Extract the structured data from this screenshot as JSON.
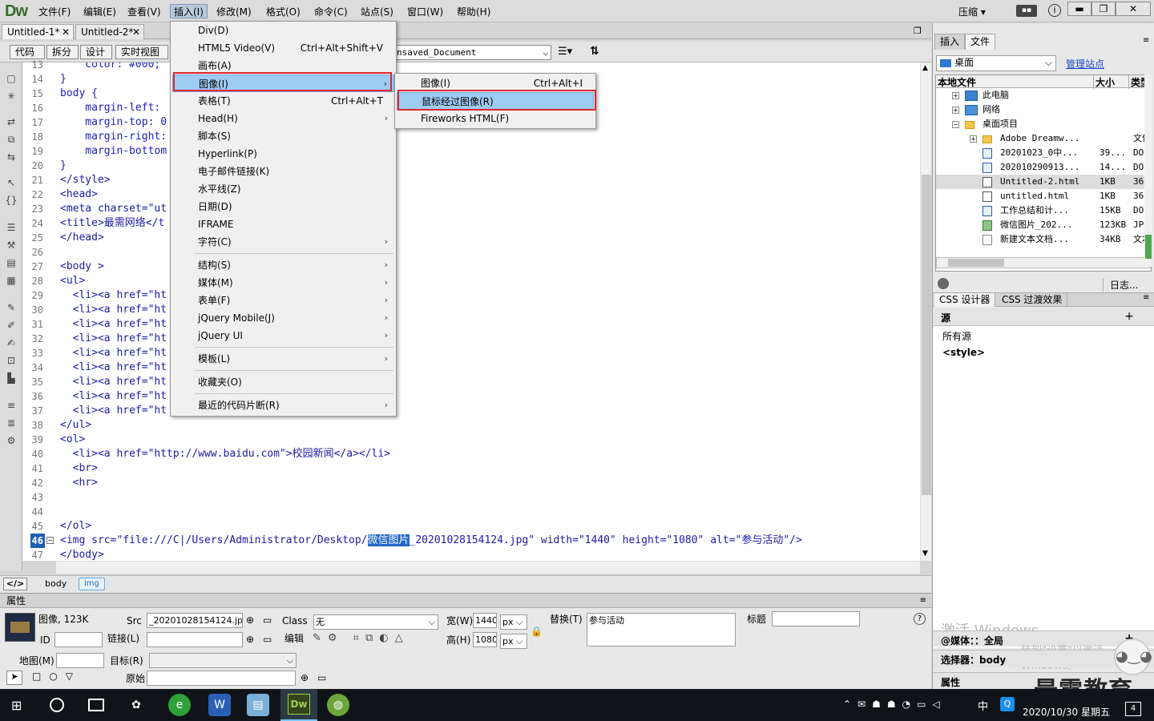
{
  "app": {
    "logo": "Dw"
  },
  "menubar": [
    "文件(F)",
    "编辑(E)",
    "查看(V)",
    "插入(I)",
    "修改(M)",
    "格式(O)",
    "命令(C)",
    "站点(S)",
    "窗口(W)",
    "帮助(H)"
  ],
  "window": {
    "workspace": "压缩",
    "search": "▾",
    "min": "▬",
    "max": "❐",
    "close": "✕"
  },
  "doctabs": [
    {
      "label": "Untitled-1*"
    },
    {
      "label": "Untitled-2*"
    }
  ],
  "toolbar": {
    "code": "代码",
    "split": "拆分",
    "design": "设计",
    "live": "实时视图",
    "doc_title": "nsaved_Document"
  },
  "code_lines": [
    {
      "n": "13",
      "t": "    color: #000;"
    },
    {
      "n": "14",
      "t": "}"
    },
    {
      "n": "15",
      "t": "body {"
    },
    {
      "n": "16",
      "t": "    margin-left:"
    },
    {
      "n": "17",
      "t": "    margin-top: 0"
    },
    {
      "n": "18",
      "t": "    margin-right:"
    },
    {
      "n": "19",
      "t": "    margin-bottom"
    },
    {
      "n": "20",
      "t": "}"
    },
    {
      "n": "21",
      "t": "</style>"
    },
    {
      "n": "22",
      "t": "<head>"
    },
    {
      "n": "23",
      "t": "<meta charset=\"ut"
    },
    {
      "n": "24",
      "t": "<title>最需网络</t"
    },
    {
      "n": "25",
      "t": "</head>"
    },
    {
      "n": "26",
      "t": ""
    },
    {
      "n": "27",
      "t": "<body >"
    },
    {
      "n": "28",
      "t": "<ul>"
    },
    {
      "n": "29",
      "t": "  <li><a href=\"ht"
    },
    {
      "n": "30",
      "t": "  <li><a href=\"ht"
    },
    {
      "n": "31",
      "t": "  <li><a href=\"ht"
    },
    {
      "n": "32",
      "t": "  <li><a href=\"ht"
    },
    {
      "n": "33",
      "t": "  <li><a href=\"ht"
    },
    {
      "n": "34",
      "t": "  <li><a href=\"ht"
    },
    {
      "n": "35",
      "t": "  <li><a href=\"ht"
    },
    {
      "n": "36",
      "t": "  <li><a href=\"ht"
    },
    {
      "n": "37",
      "t": "  <li><a href=\"ht"
    },
    {
      "n": "38",
      "t": "</ul>"
    },
    {
      "n": "39",
      "t": "<ol>"
    },
    {
      "n": "40",
      "t": "  <li><a href=\"http://www.baidu.com\">校园新闻</a></li>"
    },
    {
      "n": "41",
      "t": "  <br>"
    },
    {
      "n": "42",
      "t": "  <hr>"
    },
    {
      "n": "43",
      "t": ""
    },
    {
      "n": "44",
      "t": ""
    },
    {
      "n": "45",
      "t": "</ol>"
    },
    {
      "n": "46",
      "t": ""
    },
    {
      "n": "47",
      "t": "</body>"
    }
  ],
  "img_line": {
    "pre": "<img src=\"file:///C|/Users/Administrator/Desktop/",
    "sel": "微信图片",
    "post": "_20201028154124.jpg\" width=\"1440\" height=\"1080\" alt=\"参与活动\"/>"
  },
  "tagbar": {
    "code_btn": "</>",
    "body": "body",
    "img": "img"
  },
  "props": {
    "title": "属性",
    "kind": "图像, 123K",
    "src_label": "Src",
    "src_value": "_20201028154124.jpg",
    "class_label": "Class",
    "class_value": "无",
    "width_label": "宽(W)",
    "width_value": "1440",
    "height_label": "高(H)",
    "height_value": "1080",
    "unit": "px",
    "alt_label": "替换(T)",
    "alt_value": "参与活动",
    "title_label": "标题",
    "id_label": "ID",
    "link_label": "链接(L)",
    "edit_label": "编辑",
    "map_label": "地图(M)",
    "target_label": "目标(R)",
    "original_label": "原始"
  },
  "right": {
    "tabs": [
      "插入",
      "文件"
    ],
    "location": "桌面",
    "manage": "管理站点",
    "col_name": "本地文件",
    "col_size": "大小",
    "col_type": "类型",
    "files": [
      {
        "name": "此电脑",
        "size": "",
        "type": "",
        "icon": "pc",
        "indent": 1
      },
      {
        "name": "网络",
        "size": "",
        "type": "",
        "icon": "net",
        "indent": 1
      },
      {
        "name": "桌面项目",
        "size": "",
        "type": "",
        "icon": "folder",
        "indent": 1
      },
      {
        "name": "Adobe Dreamw...",
        "size": "",
        "type": "文件",
        "icon": "folder",
        "indent": 2
      },
      {
        "name": "20201023_0中...",
        "size": "39...",
        "type": "DOCX",
        "icon": "word",
        "indent": 2
      },
      {
        "name": "202010290913...",
        "size": "14...",
        "type": "DOCX",
        "icon": "word",
        "indent": 2
      },
      {
        "name": "Untitled-2.html",
        "size": "1KB",
        "type": "360",
        "icon": "html",
        "indent": 2
      },
      {
        "name": "untitled.html",
        "size": "1KB",
        "type": "360",
        "icon": "html",
        "indent": 2
      },
      {
        "name": "工作总结和计...",
        "size": "15KB",
        "type": "DOC",
        "icon": "word",
        "indent": 2
      },
      {
        "name": "微信图片_202...",
        "size": "123KB",
        "type": "JPG",
        "icon": "img",
        "indent": 2
      },
      {
        "name": "新建文本文档...",
        "size": "34KB",
        "type": "文本",
        "icon": "txt",
        "indent": 2
      }
    ],
    "log": "日志...",
    "css_tabs": [
      "CSS 设计器",
      "CSS 过渡效果"
    ],
    "source_label": "源",
    "source_all": "所有源",
    "source_style": "<style>",
    "media_label": "@媒体：：全局",
    "selector_label": "选择器：body",
    "attr_label": "属性",
    "watermark1": "激活 Windows",
    "watermark2": "转到\"设置\"以激活 Windows。"
  },
  "insert_menu": [
    {
      "label": "Div(D)",
      "sc": "",
      "arrow": false
    },
    {
      "label": "HTML5 Video(V)",
      "sc": "Ctrl+Alt+Shift+V",
      "arrow": false
    },
    {
      "label": "画布(A)",
      "sc": "",
      "arrow": false
    },
    {
      "label": "图像(I)",
      "sc": "",
      "arrow": true,
      "hl": true
    },
    {
      "label": "表格(T)",
      "sc": "Ctrl+Alt+T",
      "arrow": false
    },
    {
      "label": "Head(H)",
      "sc": "",
      "arrow": true
    },
    {
      "label": "脚本(S)",
      "sc": "",
      "arrow": false
    },
    {
      "label": "Hyperlink(P)",
      "sc": "",
      "arrow": false
    },
    {
      "label": "电子邮件链接(K)",
      "sc": "",
      "arrow": false
    },
    {
      "label": "水平线(Z)",
      "sc": "",
      "arrow": false
    },
    {
      "label": "日期(D)",
      "sc": "",
      "arrow": false
    },
    {
      "label": "IFRAME",
      "sc": "",
      "arrow": false
    },
    {
      "label": "字符(C)",
      "sc": "",
      "arrow": true
    },
    {
      "sep": true
    },
    {
      "label": "结构(S)",
      "sc": "",
      "arrow": true
    },
    {
      "label": "媒体(M)",
      "sc": "",
      "arrow": true
    },
    {
      "label": "表单(F)",
      "sc": "",
      "arrow": true
    },
    {
      "label": "jQuery Mobile(J)",
      "sc": "",
      "arrow": true
    },
    {
      "label": "jQuery UI",
      "sc": "",
      "arrow": true
    },
    {
      "sep": true
    },
    {
      "label": "模板(L)",
      "sc": "",
      "arrow": true
    },
    {
      "sep": true
    },
    {
      "label": "收藏夹(O)",
      "sc": "",
      "arrow": false
    },
    {
      "sep": true
    },
    {
      "label": "最近的代码片断(R)",
      "sc": "",
      "arrow": true
    }
  ],
  "image_submenu": [
    {
      "label": "图像(I)",
      "sc": "Ctrl+Alt+I"
    },
    {
      "label": "鼠标经过图像(R)",
      "sc": "",
      "hl": true
    },
    {
      "label": "Fireworks HTML(F)",
      "sc": ""
    }
  ],
  "taskbar": {
    "time": "2020/10/30 星期五",
    "ime": "中",
    "brand": "最需教育",
    "badge": "4"
  }
}
